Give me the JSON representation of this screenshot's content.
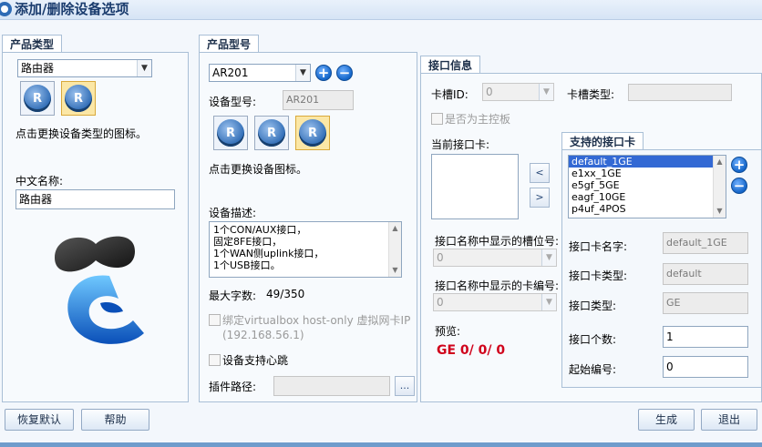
{
  "window": {
    "title": "添加/删除设备选项"
  },
  "product_type": {
    "tab": "产品类型",
    "selected": "路由器",
    "hint": "点击更换设备类型的图标。",
    "cn_name_label": "中文名称:",
    "cn_name_value": "路由器"
  },
  "product_model": {
    "tab": "产品型号",
    "selected": "AR201",
    "model_label": "设备型号:",
    "model_value": "AR201",
    "hint": "点击更换设备图标。",
    "desc_label": "设备描述:",
    "desc_lines": [
      "1个CON/AUX接口，",
      "固定8FE接口，",
      "1个WAN侧uplink接口，",
      "1个USB接口。"
    ],
    "max_chars_label": "最大字数:",
    "max_chars_value": "49/350",
    "bind_vbox_label": "绑定virtualbox host-only 虚拟网卡IP",
    "bind_vbox_ip": "(192.168.56.1)",
    "heartbeat_label": "设备支持心跳",
    "plugin_path_label": "插件路径:",
    "browse_label": "..."
  },
  "interface_info": {
    "tab": "接口信息",
    "slot_id_label": "卡槽ID:",
    "slot_id_value": "0",
    "slot_type_label": "卡槽类型:",
    "is_main_label": "是否为主控板",
    "current_card_label": "当前接口卡:",
    "move_left": "<",
    "move_right": ">",
    "slot_num_label": "接口名称中显示的槽位号:",
    "slot_num_value": "0",
    "card_num_label": "接口名称中显示的卡编号:",
    "card_num_value": "0",
    "preview_label": "预览:",
    "preview_value": "GE  0/ 0/ 0"
  },
  "supported_cards": {
    "tab": "支持的接口卡",
    "items": [
      "default_1GE",
      "e1xx_1GE",
      "e5gf_5GE",
      "eagf_10GE",
      "p4uf_4POS"
    ],
    "card_name_label": "接口卡名字:",
    "card_name_value": "default_1GE",
    "card_type_label": "接口卡类型:",
    "card_type_value": "default",
    "if_type_label": "接口类型:",
    "if_type_value": "GE",
    "if_count_label": "接口个数:",
    "if_count_value": "1",
    "start_num_label": "起始编号:",
    "start_num_value": "0"
  },
  "footer": {
    "restore_label": "恢复默认",
    "help_label": "帮助",
    "generate_label": "生成",
    "exit_label": "退出"
  }
}
